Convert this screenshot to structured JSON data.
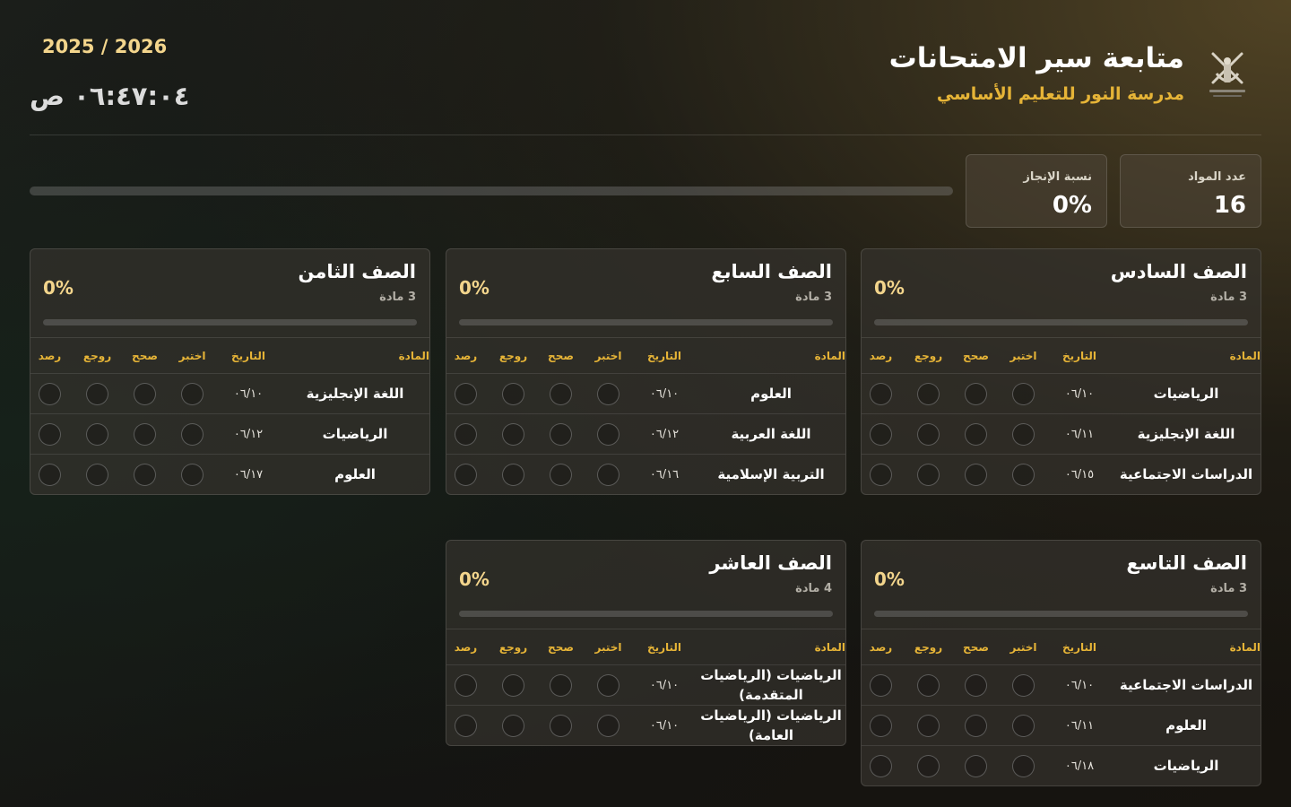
{
  "header": {
    "title": "متابعة سير الامتحانات",
    "school": "مدرسة النور للتعليم الأساسي",
    "academic_year": "2025 / 2026",
    "clock": "٠٦:٤٧:٠٤ ص",
    "logo_icon": "oman-emblem-icon"
  },
  "stats": {
    "subjects_label": "عدد المواد",
    "subjects_value": "16",
    "progress_label": "نسبة الإنجاز",
    "progress_value": "0%",
    "progress_fraction": 0
  },
  "columns": {
    "subject": "المادة",
    "date": "التاريخ",
    "tested": "اختبر",
    "corrected": "صحح",
    "reviewed": "روجع",
    "recorded": "رصد"
  },
  "grades": [
    {
      "name": "الصف السادس",
      "count": "3 مادة",
      "percent": "0%",
      "fraction": 0,
      "rows": [
        {
          "subject": "الرياضيات",
          "date": "٠٦/١٠"
        },
        {
          "subject": "اللغة الإنجليزية",
          "date": "٠٦/١١"
        },
        {
          "subject": "الدراسات الاجتماعية",
          "date": "٠٦/١٥"
        }
      ]
    },
    {
      "name": "الصف السابع",
      "count": "3 مادة",
      "percent": "0%",
      "fraction": 0,
      "rows": [
        {
          "subject": "العلوم",
          "date": "٠٦/١٠"
        },
        {
          "subject": "اللغة العربية",
          "date": "٠٦/١٢"
        },
        {
          "subject": "التربية الإسلامية",
          "date": "٠٦/١٦"
        }
      ]
    },
    {
      "name": "الصف الثامن",
      "count": "3 مادة",
      "percent": "0%",
      "fraction": 0,
      "rows": [
        {
          "subject": "اللغة الإنجليزية",
          "date": "٠٦/١٠"
        },
        {
          "subject": "الرياضيات",
          "date": "٠٦/١٢"
        },
        {
          "subject": "العلوم",
          "date": "٠٦/١٧"
        }
      ]
    },
    {
      "name": "الصف التاسع",
      "count": "3 مادة",
      "percent": "0%",
      "fraction": 0,
      "rows": [
        {
          "subject": "الدراسات الاجتماعية",
          "date": "٠٦/١٠"
        },
        {
          "subject": "العلوم",
          "date": "٠٦/١١"
        },
        {
          "subject": "الرياضيات",
          "date": "٠٦/١٨"
        }
      ]
    },
    {
      "name": "الصف العاشر",
      "count": "4 مادة",
      "percent": "0%",
      "fraction": 0,
      "rows": [
        {
          "subject": "الرياضيات (الرياضيات المتقدمة)",
          "date": "٠٦/١٠"
        },
        {
          "subject": "الرياضيات (الرياضيات العامة)",
          "date": "٠٦/١٠"
        }
      ]
    }
  ],
  "colors": {
    "accent": "#e6b437",
    "accent_light": "#f3d58c"
  }
}
